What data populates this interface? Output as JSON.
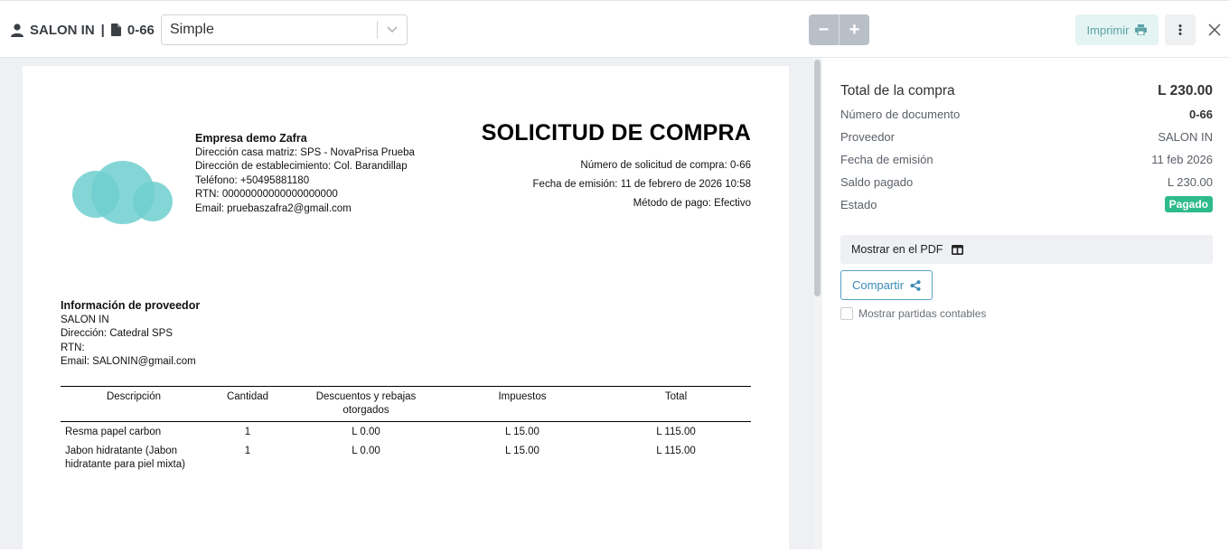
{
  "header": {
    "supplier": "SALON IN",
    "separator": "|",
    "doc_number": "0-66",
    "template_select": "Simple",
    "zoom_out": "−",
    "zoom_in": "+",
    "print_label": "Imprimir"
  },
  "document": {
    "company": {
      "name": "Empresa demo Zafra",
      "lines": [
        "Dirección casa matriz: SPS - NovaPrisa Prueba",
        "Dirección de establecimiento: Col. Barandillap",
        "Teléfono: +50495881180",
        "RTN: 00000000000000000000",
        "Email: pruebaszafra2@gmail.com"
      ]
    },
    "title": "SOLICITUD DE COMPRA",
    "meta": [
      "Número de solicitud de compra: 0-66",
      "Fecha de emisión: 11 de febrero de 2026 10:58",
      "Método de pago: Efectivo"
    ],
    "provider": {
      "heading": "Información de proveedor",
      "lines": [
        "SALON IN",
        "Dirección: Catedral SPS",
        "RTN:",
        "Email: SALONIN@gmail.com"
      ]
    },
    "table": {
      "headers": [
        "Descripción",
        "Cantidad",
        "Descuentos y rebajas otorgados",
        "Impuestos",
        "Total"
      ],
      "rows": [
        [
          "Resma papel carbon",
          "1",
          "L 0.00",
          "L 15.00",
          "L 115.00"
        ],
        [
          "Jabon hidratante (Jabon hidratante para piel mixta)",
          "1",
          "L 0.00",
          "L 15.00",
          "L 115.00"
        ]
      ]
    }
  },
  "summary": {
    "total_label": "Total de la compra",
    "total_value": "L 230.00",
    "fields": [
      {
        "label": "Número de documento",
        "value": "0-66"
      },
      {
        "label": "Proveedor",
        "value": "SALON IN"
      },
      {
        "label": "Fecha de emisión",
        "value": "11 feb 2026"
      },
      {
        "label": "Saldo pagado",
        "value": "L 230.00"
      },
      {
        "label": "Estado",
        "value": "Pagado"
      }
    ],
    "show_pdf": "Mostrar en el PDF",
    "share": "Compartir",
    "show_entries": "Mostrar partidas contables"
  },
  "colors": {
    "status_paid": "#2ebb8a",
    "print_accent": "#5ba3a6",
    "share_accent": "#3a8bb8",
    "logo": "#6fcfcf"
  }
}
